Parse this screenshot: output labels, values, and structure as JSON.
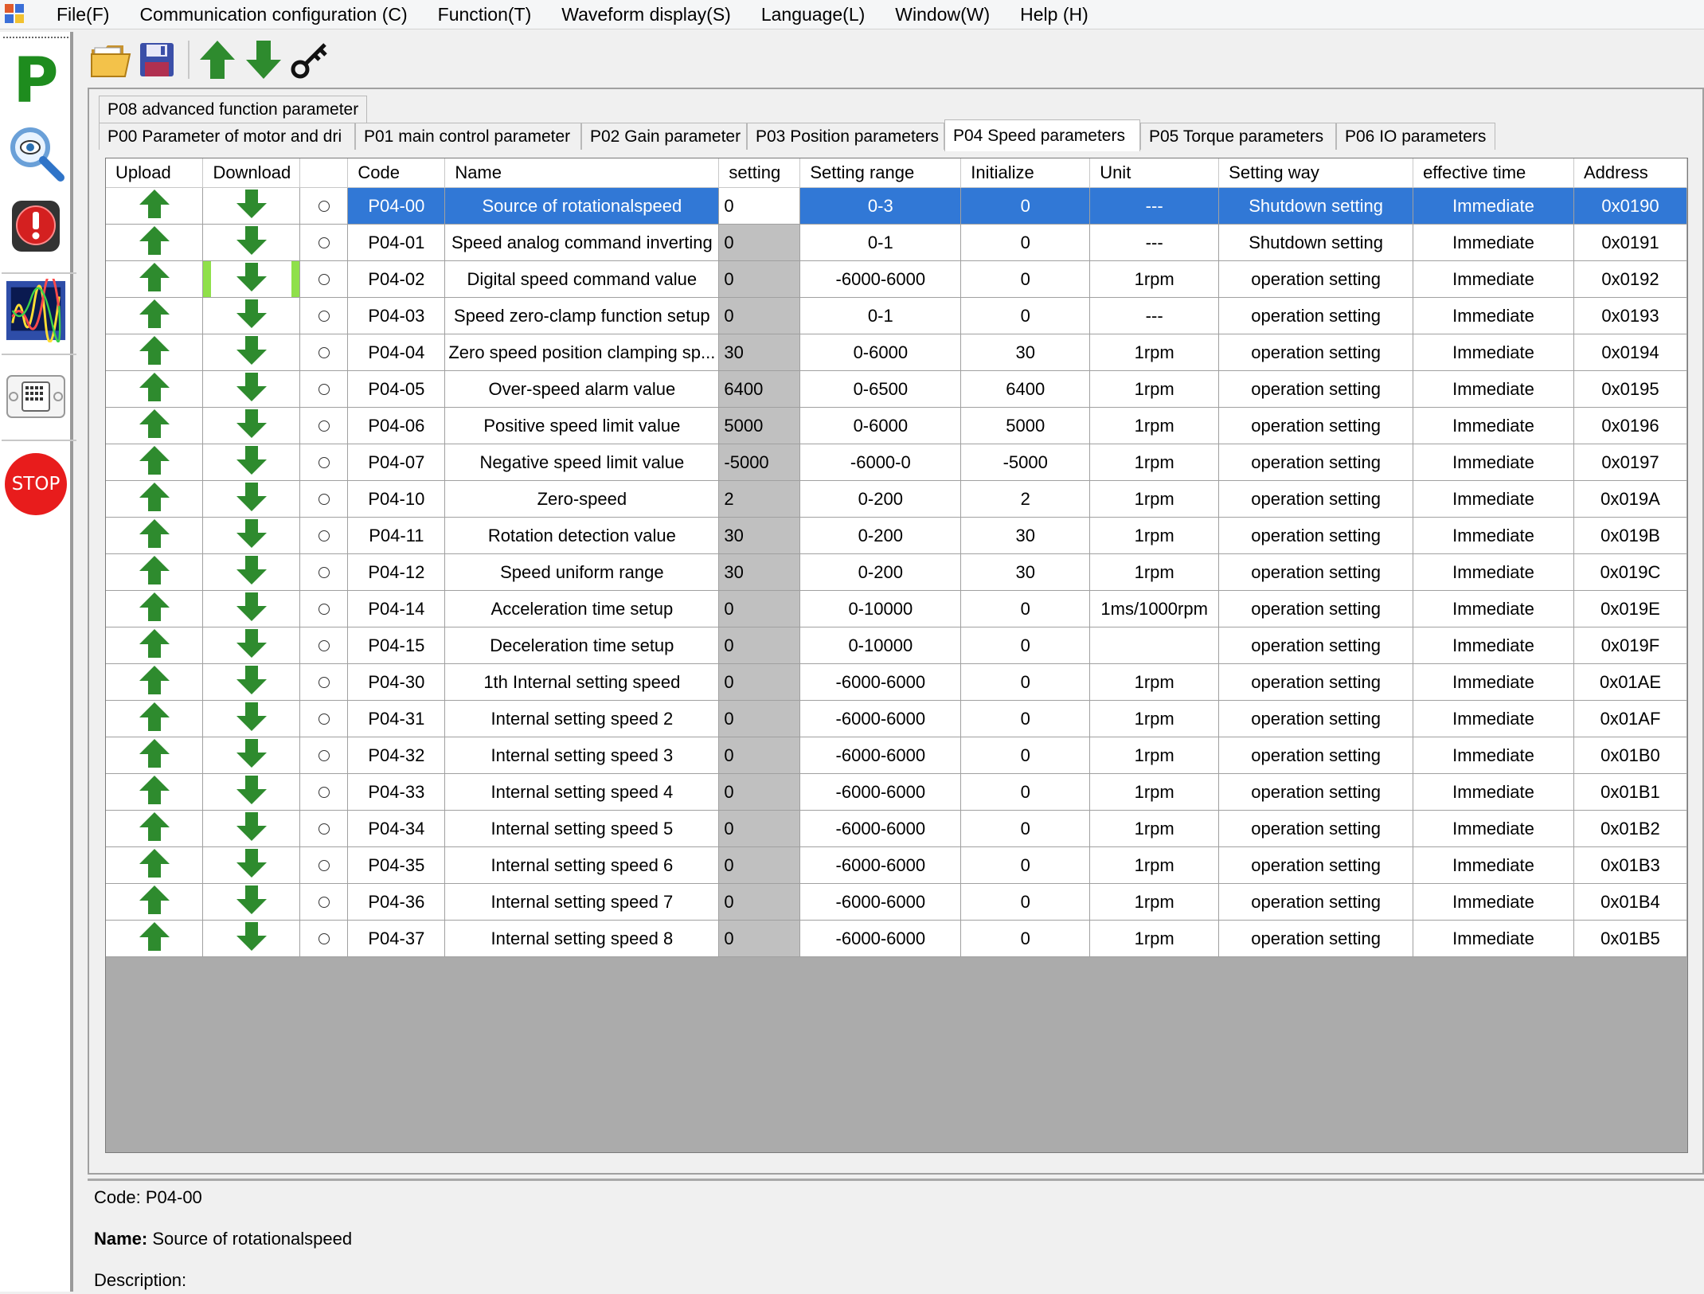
{
  "menu": {
    "items": [
      "File(F)",
      "Communication configuration (C)",
      "Function(T)",
      "Waveform display(S)",
      "Language(L)",
      "Window(W)",
      "Help (H)"
    ]
  },
  "sidebar": {
    "icons": [
      "parameter-icon",
      "monitor-magnifier-icon",
      "alarm-icon",
      "oscilloscope-icon",
      "keypad-icon",
      "stop-icon"
    ],
    "parameter_label": "P",
    "stop_label": "STOP"
  },
  "toolbar": {
    "icons": [
      "open-folder-icon",
      "save-icon",
      "upload-arrow-icon",
      "download-arrow-icon",
      "key-icon"
    ]
  },
  "tabs": {
    "row1": [
      "P08 advanced function parameter"
    ],
    "row2": [
      "P00  Parameter of motor and dri",
      "P01 main control parameter",
      "P02 Gain parameter",
      "P03 Position parameters",
      "P04 Speed parameters",
      "P05 Torque parameters",
      "P06 IO parameters"
    ],
    "active": "P04 Speed parameters"
  },
  "table": {
    "columns": [
      "Upload",
      "Download",
      "",
      "Code",
      "Name",
      "setting",
      "Setting range",
      "Initialize",
      "Unit",
      "Setting way",
      "effective time",
      "Address"
    ],
    "rows": [
      [
        "P04-00",
        "Source of rotationalspeed",
        "0",
        "0-3",
        "0",
        "---",
        "Shutdown setting",
        "Immediate",
        "0x0190"
      ],
      [
        "P04-01",
        "Speed analog command inverting",
        "0",
        "0-1",
        "0",
        "---",
        "Shutdown setting",
        "Immediate",
        "0x0191"
      ],
      [
        "P04-02",
        "Digital speed command value",
        "0",
        "-6000-6000",
        "0",
        "1rpm",
        "operation setting",
        "Immediate",
        "0x0192"
      ],
      [
        "P04-03",
        "Speed zero-clamp function setup",
        "0",
        "0-1",
        "0",
        "---",
        "operation setting",
        "Immediate",
        "0x0193"
      ],
      [
        "P04-04",
        "Zero speed position clamping sp...",
        "30",
        "0-6000",
        "30",
        "1rpm",
        "operation setting",
        "Immediate",
        "0x0194"
      ],
      [
        "P04-05",
        "Over-speed alarm value",
        "6400",
        "0-6500",
        "6400",
        "1rpm",
        "operation setting",
        "Immediate",
        "0x0195"
      ],
      [
        "P04-06",
        "Positive speed limit value",
        "5000",
        "0-6000",
        "5000",
        "1rpm",
        "operation setting",
        "Immediate",
        "0x0196"
      ],
      [
        "P04-07",
        "Negative speed limit value",
        "-5000",
        "-6000-0",
        "-5000",
        "1rpm",
        "operation setting",
        "Immediate",
        "0x0197"
      ],
      [
        "P04-10",
        "Zero-speed",
        "2",
        "0-200",
        "2",
        "1rpm",
        "operation setting",
        "Immediate",
        "0x019A"
      ],
      [
        "P04-11",
        "Rotation detection value",
        "30",
        "0-200",
        "30",
        "1rpm",
        "operation setting",
        "Immediate",
        "0x019B"
      ],
      [
        "P04-12",
        "Speed uniform range",
        "30",
        "0-200",
        "30",
        "1rpm",
        "operation setting",
        "Immediate",
        "0x019C"
      ],
      [
        "P04-14",
        "Acceleration time setup",
        "0",
        "0-10000",
        "0",
        "1ms/1000rpm",
        "operation setting",
        "Immediate",
        "0x019E"
      ],
      [
        "P04-15",
        "Deceleration time setup",
        "0",
        "0-10000",
        "0",
        "",
        "operation setting",
        "Immediate",
        "0x019F"
      ],
      [
        "P04-30",
        "1th Internal setting speed",
        "0",
        "-6000-6000",
        "0",
        "1rpm",
        "operation setting",
        "Immediate",
        "0x01AE"
      ],
      [
        "P04-31",
        "Internal setting speed 2",
        "0",
        "-6000-6000",
        "0",
        "1rpm",
        "operation setting",
        "Immediate",
        "0x01AF"
      ],
      [
        "P04-32",
        "Internal setting speed 3",
        "0",
        "-6000-6000",
        "0",
        "1rpm",
        "operation setting",
        "Immediate",
        "0x01B0"
      ],
      [
        "P04-33",
        "Internal setting speed 4",
        "0",
        "-6000-6000",
        "0",
        "1rpm",
        "operation setting",
        "Immediate",
        "0x01B1"
      ],
      [
        "P04-34",
        "Internal setting speed 5",
        "0",
        "-6000-6000",
        "0",
        "1rpm",
        "operation setting",
        "Immediate",
        "0x01B2"
      ],
      [
        "P04-35",
        "Internal setting speed 6",
        "0",
        "-6000-6000",
        "0",
        "1rpm",
        "operation setting",
        "Immediate",
        "0x01B3"
      ],
      [
        "P04-36",
        "Internal setting speed 7",
        "0",
        "-6000-6000",
        "0",
        "1rpm",
        "operation setting",
        "Immediate",
        "0x01B4"
      ],
      [
        "P04-37",
        "Internal setting speed 8",
        "0",
        "-6000-6000",
        "0",
        "1rpm",
        "operation setting",
        "Immediate",
        "0x01B5"
      ]
    ],
    "selected_row": 0,
    "highlighted_download_row": 2
  },
  "description": {
    "code_label": "Code:",
    "code_value": "P04-00",
    "name_label": "Name:",
    "name_value": "Source of rotationalspeed",
    "description_label": "Description:"
  },
  "colors": {
    "selection": "#3178d6",
    "arrow_green": "#2e8b2e",
    "grid_background": "#ababab",
    "setting_column": "#c0c0c0"
  }
}
